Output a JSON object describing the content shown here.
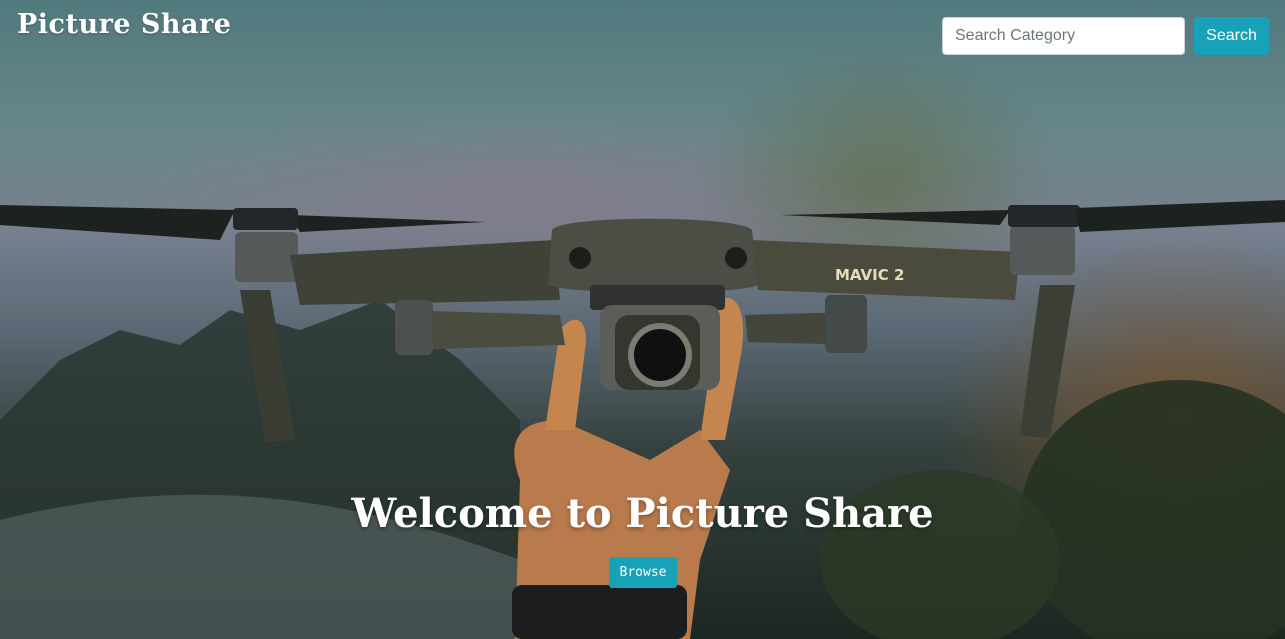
{
  "navbar": {
    "brand": "Picture Share",
    "search": {
      "placeholder": "Search Category",
      "value": "",
      "button_label": "Search"
    }
  },
  "hero": {
    "heading": "Welcome to Picture Share",
    "browse_label": "Browse",
    "image_text": "MAVIC 2"
  },
  "colors": {
    "accent": "#17a2b8",
    "text_light": "#ffffff"
  }
}
